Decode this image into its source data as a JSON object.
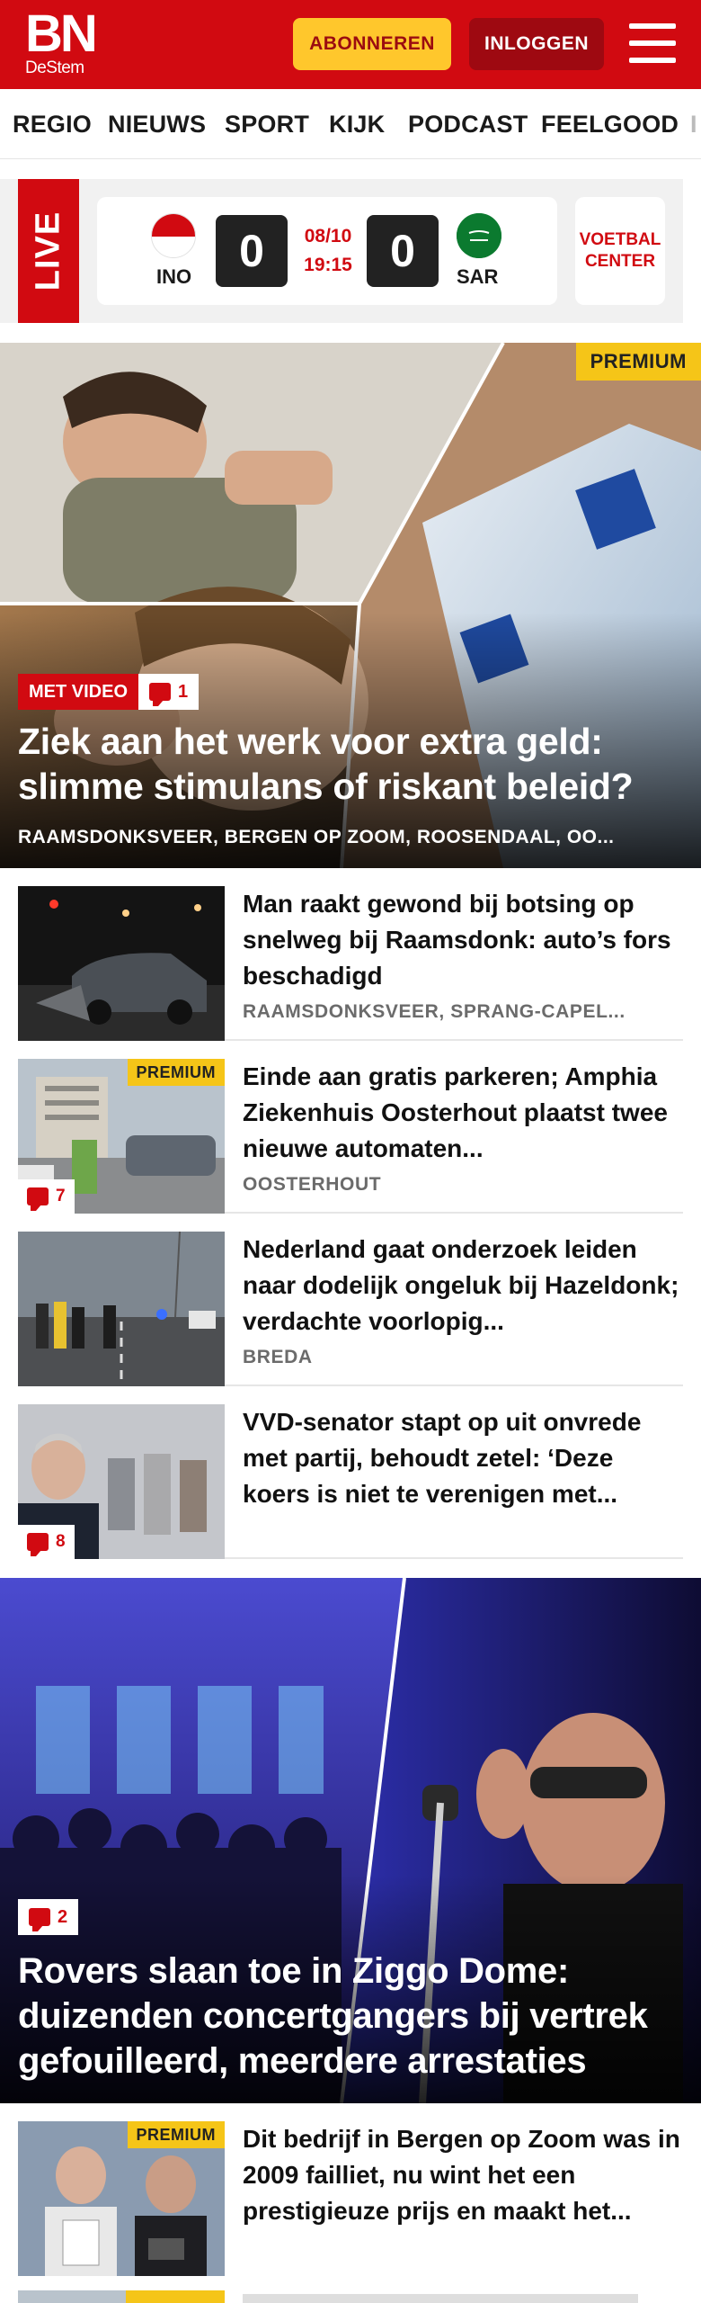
{
  "header": {
    "logo_main": "BN",
    "logo_sub": "DeStem",
    "subscribe_label": "ABONNEREN",
    "login_label": "INLOGGEN"
  },
  "nav": {
    "items": [
      "REGIO",
      "NIEUWS",
      "SPORT",
      "KIJK",
      "PODCAST",
      "FEELGOOD"
    ]
  },
  "live": {
    "badge": "LIVE",
    "home_team": "INO",
    "away_team": "SAR",
    "home_score": "0",
    "away_score": "0",
    "date": "08/10",
    "time": "19:15",
    "center_label_1": "VOETBAL",
    "center_label_2": "CENTER"
  },
  "hero": {
    "premium": "PREMIUM",
    "video_badge": "MET VIDEO",
    "comments": "1",
    "title": "Ziek aan het werk voor extra geld: slimme stimulans of riskant beleid?",
    "locations": "RAAMSDONKSVEER, BERGEN OP ZOOM, ROOSENDAAL, OO..."
  },
  "articles": [
    {
      "title": "Man raakt gewond bij botsing op snelweg bij Raamsdonk: auto’s fors beschadigd",
      "location": "RAAMSDONKSVEER, SPRANG-CAPEL..."
    },
    {
      "premium": "PREMIUM",
      "comments": "7",
      "title": "Einde aan gratis parkeren; Amphia Ziekenhuis Oosterhout plaatst twee nieuwe automaten...",
      "location": "OOSTERHOUT"
    },
    {
      "title": "Nederland gaat onderzoek leiden naar dodelijk ongeluk bij Hazeldonk; verdachte voorlopig...",
      "location": "BREDA"
    },
    {
      "comments": "8",
      "title": "VVD-senator stapt op uit onvrede met partij, behoudt zetel: ‘Deze koers is niet te verenigen met...",
      "location": ""
    }
  ],
  "hero2": {
    "comments": "2",
    "title": "Rovers slaan toe in Ziggo Dome: duizenden concertgangers bij vertrek gefouilleerd, meerdere arrestaties"
  },
  "article_bottom": {
    "premium": "PREMIUM",
    "title": "Dit bedrijf in Bergen op Zoom was in 2009 failliet, nu wint het een prestigieuze prijs en maakt het..."
  }
}
